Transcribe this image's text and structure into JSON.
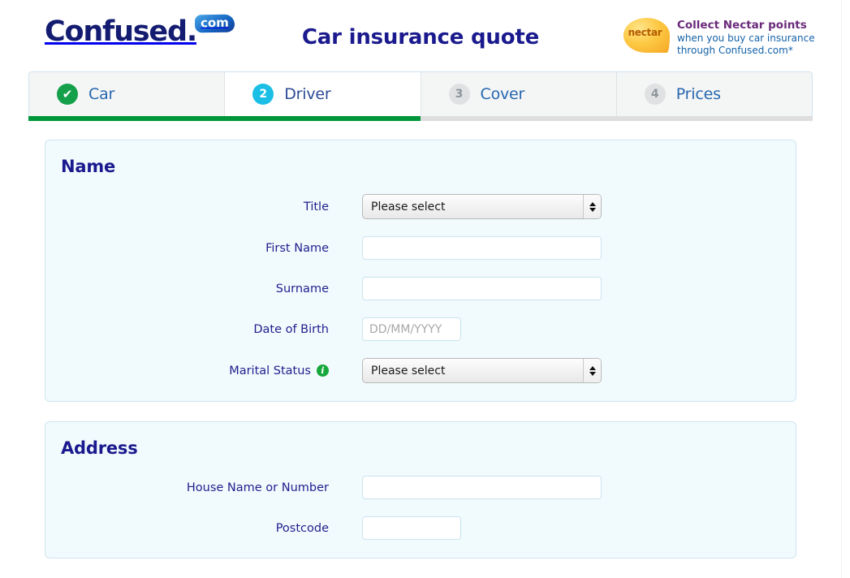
{
  "brand": {
    "logo_word": "Confused.",
    "logo_badge": "com",
    "accent_navy": "#131c70",
    "accent_blue": "#1462c0"
  },
  "header": {
    "title": "Car insurance quote",
    "promo": {
      "badge_text": "nectar",
      "headline": "Collect Nectar points",
      "line1": "when you buy car insurance",
      "line2": "through Confused.com*",
      "headline_color": "#6a2a7a",
      "body_color": "#1462a8"
    }
  },
  "progress": {
    "percent": 50,
    "fill_color": "#009639",
    "track_color": "#dedede"
  },
  "tabs": [
    {
      "badge": "✔",
      "label": "Car",
      "state": "done",
      "icon_name": "check-icon"
    },
    {
      "badge": "2",
      "label": "Driver",
      "state": "current",
      "icon_name": "step-number-2"
    },
    {
      "badge": "3",
      "label": "Cover",
      "state": "todo",
      "icon_name": "step-number-3"
    },
    {
      "badge": "4",
      "label": "Prices",
      "state": "todo",
      "icon_name": "step-number-4"
    }
  ],
  "sections": [
    {
      "title": "Name",
      "fields": [
        {
          "label": "Title",
          "type": "select",
          "value": "Please select",
          "info": false
        },
        {
          "label": "First Name",
          "type": "text",
          "value": "",
          "placeholder": "",
          "width": "wide",
          "info": false
        },
        {
          "label": "Surname",
          "type": "text",
          "value": "",
          "placeholder": "",
          "width": "wide",
          "info": false
        },
        {
          "label": "Date of Birth",
          "type": "text",
          "value": "",
          "placeholder": "DD/MM/YYYY",
          "width": "narrow",
          "info": false
        },
        {
          "label": "Marital Status",
          "type": "select",
          "value": "Please select",
          "info": true,
          "info_icon": "info-icon"
        }
      ]
    },
    {
      "title": "Address",
      "fields": [
        {
          "label": "House Name or Number",
          "type": "text",
          "value": "",
          "placeholder": "",
          "width": "wide",
          "info": false
        },
        {
          "label": "Postcode",
          "type": "text",
          "value": "",
          "placeholder": "",
          "width": "narrow",
          "info": false
        }
      ]
    }
  ]
}
